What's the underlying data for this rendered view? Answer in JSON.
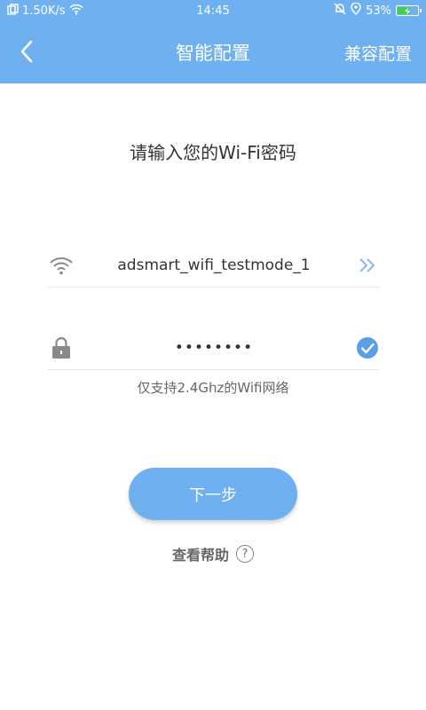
{
  "status_bar": {
    "speed": "1.50K/s",
    "time": "14:45",
    "battery_percent": "53%",
    "battery_level": 0.53
  },
  "title_bar": {
    "title": "智能配置",
    "right_action": "兼容配置"
  },
  "main": {
    "prompt": "请输入您的Wi-Fi密码",
    "ssid": "adsmart_wifi_testmode_1",
    "password_value": "••••••••",
    "hint": "仅支持2.4Ghz的Wifi网络",
    "next_button": "下一步",
    "help_link": "查看帮助",
    "help_symbol": "?"
  },
  "colors": {
    "accent": "#6fb1f0",
    "check": "#5b9de6"
  },
  "icons": [
    "copy-icon",
    "wifi-signal-icon",
    "back-arrow-icon",
    "wifi-icon",
    "double-chevron-right-icon",
    "lock-icon",
    "check-circle-icon",
    "help-icon",
    "bell-muted-icon",
    "location-icon",
    "battery-icon"
  ]
}
